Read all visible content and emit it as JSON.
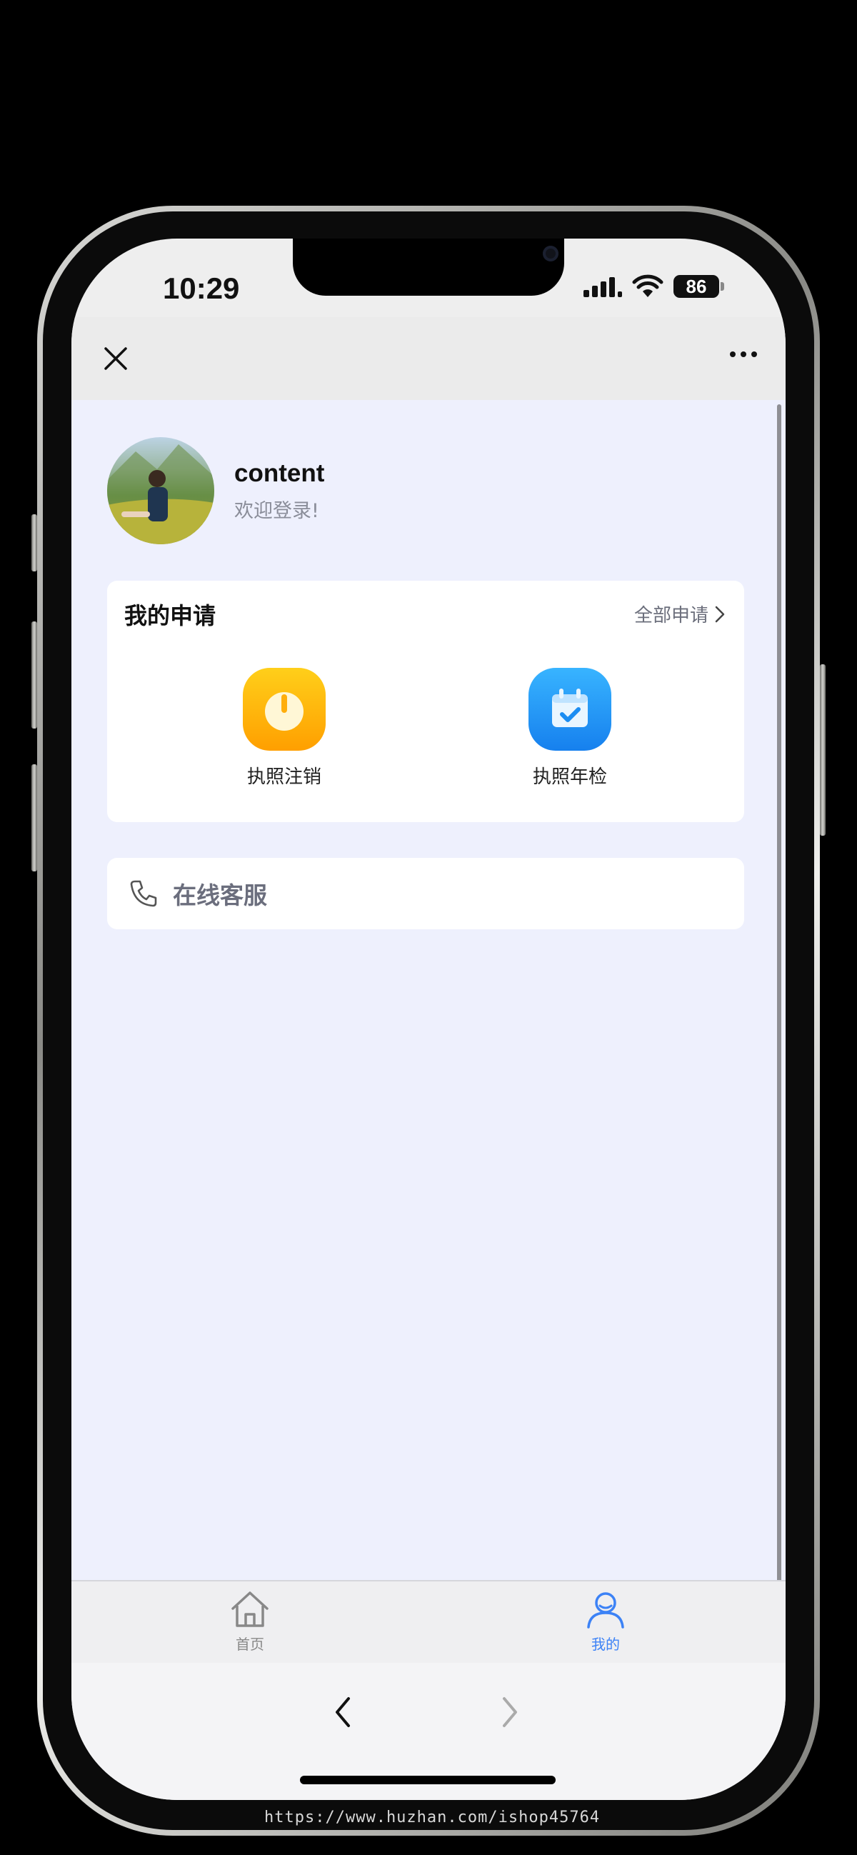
{
  "status_bar": {
    "time": "10:29",
    "battery": "86"
  },
  "header": {
    "close_icon": "close-icon",
    "more_icon": "more-dots-icon"
  },
  "profile": {
    "username": "content",
    "welcome": "欢迎登录!"
  },
  "applications": {
    "title": "我的申请",
    "all_link": "全部申请",
    "items": [
      {
        "label": "执照注销",
        "icon": "power-icon",
        "color": "#ffb400"
      },
      {
        "label": "执照年检",
        "icon": "calendar-check-icon",
        "color": "#1e9bf5"
      }
    ]
  },
  "service": {
    "label": "在线客服",
    "icon": "phone-icon"
  },
  "tabbar": {
    "items": [
      {
        "label": "首页",
        "icon": "home-icon",
        "active": false
      },
      {
        "label": "我的",
        "icon": "user-icon",
        "active": true
      }
    ],
    "active_color": "#3c82f6",
    "inactive_color": "#888888"
  },
  "browser": {
    "back_icon": "chevron-left-icon",
    "forward_icon": "chevron-right-icon"
  },
  "watermark": "https://www.huzhan.com/ishop45764"
}
